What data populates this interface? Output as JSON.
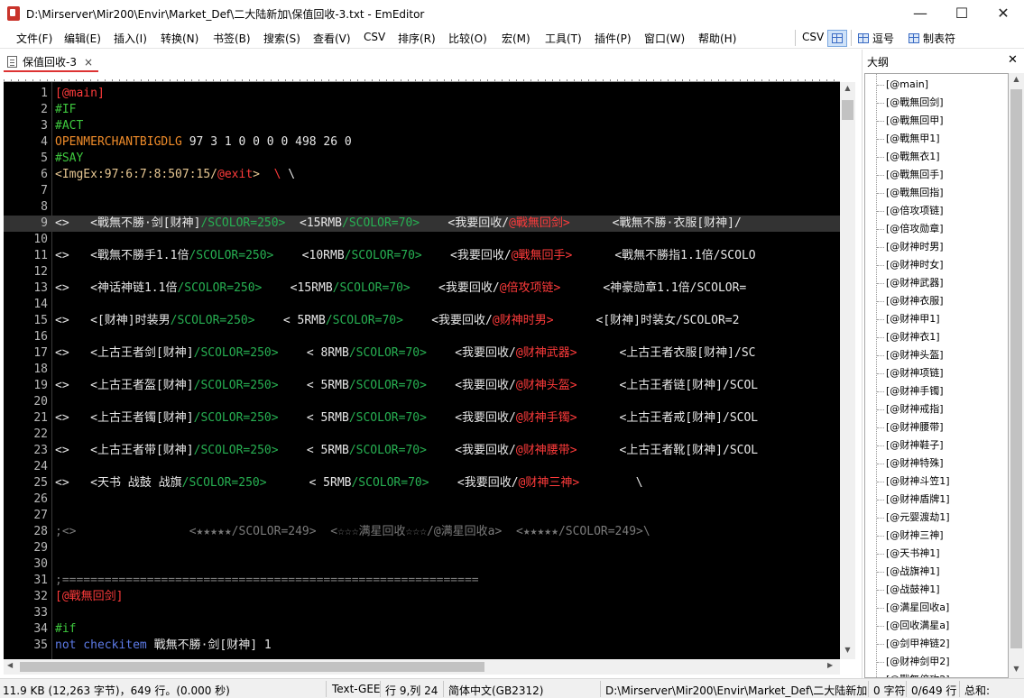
{
  "window": {
    "title": "D:\\Mirserver\\Mir200\\Envir\\Market_Def\\二大陆新加\\保值回收-3.txt - EmEditor",
    "minimize": "—",
    "maximize": "☐",
    "close": "✕"
  },
  "menu": [
    "文件(F)",
    "编辑(E)",
    "插入(I)",
    "转换(N)",
    "书签(B)",
    "搜索(S)",
    "查看(V)",
    "CSV",
    "排序(R)",
    "比较(O)",
    "宏(M)",
    "工具(T)",
    "插件(P)",
    "窗口(W)",
    "帮助(H)"
  ],
  "toolbar": {
    "csv_label": "CSV",
    "comma_label": "逗号",
    "tab_label": "制表符"
  },
  "tab": {
    "label": "保值回收-3",
    "close": "×"
  },
  "editor": {
    "current_line": 9,
    "lines": [
      {
        "n": "1",
        "segs": [
          {
            "t": "[@main]",
            "c": "r"
          }
        ]
      },
      {
        "n": "2",
        "segs": [
          {
            "t": "#IF",
            "c": "g"
          }
        ]
      },
      {
        "n": "3",
        "segs": [
          {
            "t": "#ACT",
            "c": "g"
          }
        ]
      },
      {
        "n": "4",
        "segs": [
          {
            "t": "OPENMERCHANTBIGDLG",
            "c": "o"
          },
          {
            "t": " 97 3 1 0 0 0 0 498 26 0",
            "c": "w"
          }
        ]
      },
      {
        "n": "5",
        "segs": [
          {
            "t": "#SAY",
            "c": "g"
          }
        ]
      },
      {
        "n": "6",
        "segs": [
          {
            "t": "<ImgEx:97:6:7:8:507:15/",
            "c": "t"
          },
          {
            "t": "@exit",
            "c": "r"
          },
          {
            "t": ">  ",
            "c": "t"
          },
          {
            "t": "\\",
            "c": "r"
          },
          {
            "t": " \\",
            "c": "w"
          }
        ]
      },
      {
        "n": "7",
        "segs": []
      },
      {
        "n": "8",
        "segs": []
      },
      {
        "n": "9",
        "segs": [
          {
            "t": "<>   <戰無不勝·剑[财神]",
            "c": "w"
          },
          {
            "t": "/SCOLOR=250>",
            "c": "gr"
          },
          {
            "t": "  <15RMB",
            "c": "w"
          },
          {
            "t": "/SCOLOR=70>",
            "c": "gr"
          },
          {
            "t": "    <我要回收/",
            "c": "w"
          },
          {
            "t": "@戰無回剑>",
            "c": "r"
          },
          {
            "t": "      <戰無不勝·衣服[财神]/",
            "c": "w"
          }
        ]
      },
      {
        "n": "10",
        "segs": []
      },
      {
        "n": "11",
        "segs": [
          {
            "t": "<>   <戰無不勝手1.1倍",
            "c": "w"
          },
          {
            "t": "/SCOLOR=250>",
            "c": "gr"
          },
          {
            "t": "    <10RMB",
            "c": "w"
          },
          {
            "t": "/SCOLOR=70>",
            "c": "gr"
          },
          {
            "t": "    <我要回收/",
            "c": "w"
          },
          {
            "t": "@戰無回手>",
            "c": "r"
          },
          {
            "t": "      <戰無不勝指1.1倍/SCOLO",
            "c": "w"
          }
        ]
      },
      {
        "n": "12",
        "segs": []
      },
      {
        "n": "13",
        "segs": [
          {
            "t": "<>   <神话神链1.1倍",
            "c": "w"
          },
          {
            "t": "/SCOLOR=250>",
            "c": "gr"
          },
          {
            "t": "    <15RMB",
            "c": "w"
          },
          {
            "t": "/SCOLOR=70>",
            "c": "gr"
          },
          {
            "t": "    <我要回收/",
            "c": "w"
          },
          {
            "t": "@倍攻项链>",
            "c": "r"
          },
          {
            "t": "      <神豪勋章1.1倍/SCOLOR=",
            "c": "w"
          }
        ]
      },
      {
        "n": "14",
        "segs": []
      },
      {
        "n": "15",
        "segs": [
          {
            "t": "<>   <[财神]时装男",
            "c": "w"
          },
          {
            "t": "/SCOLOR=250>",
            "c": "gr"
          },
          {
            "t": "    < 5RMB",
            "c": "w"
          },
          {
            "t": "/SCOLOR=70>",
            "c": "gr"
          },
          {
            "t": "    <我要回收/",
            "c": "w"
          },
          {
            "t": "@财神时男>",
            "c": "r"
          },
          {
            "t": "      <[财神]时装女/SCOLOR=2",
            "c": "w"
          }
        ]
      },
      {
        "n": "16",
        "segs": []
      },
      {
        "n": "17",
        "segs": [
          {
            "t": "<>   <上古王者剑[财神]",
            "c": "w"
          },
          {
            "t": "/SCOLOR=250>",
            "c": "gr"
          },
          {
            "t": "    < 8RMB",
            "c": "w"
          },
          {
            "t": "/SCOLOR=70>",
            "c": "gr"
          },
          {
            "t": "    <我要回收/",
            "c": "w"
          },
          {
            "t": "@财神武器>",
            "c": "r"
          },
          {
            "t": "      <上古王者衣服[财神]/SC",
            "c": "w"
          }
        ]
      },
      {
        "n": "18",
        "segs": []
      },
      {
        "n": "19",
        "segs": [
          {
            "t": "<>   <上古王者盔[财神]",
            "c": "w"
          },
          {
            "t": "/SCOLOR=250>",
            "c": "gr"
          },
          {
            "t": "    < 5RMB",
            "c": "w"
          },
          {
            "t": "/SCOLOR=70>",
            "c": "gr"
          },
          {
            "t": "    <我要回收/",
            "c": "w"
          },
          {
            "t": "@财神头盔>",
            "c": "r"
          },
          {
            "t": "      <上古王者链[财神]/SCOL",
            "c": "w"
          }
        ]
      },
      {
        "n": "20",
        "segs": []
      },
      {
        "n": "21",
        "segs": [
          {
            "t": "<>   <上古王者镯[财神]",
            "c": "w"
          },
          {
            "t": "/SCOLOR=250>",
            "c": "gr"
          },
          {
            "t": "    < 5RMB",
            "c": "w"
          },
          {
            "t": "/SCOLOR=70>",
            "c": "gr"
          },
          {
            "t": "    <我要回收/",
            "c": "w"
          },
          {
            "t": "@财神手镯>",
            "c": "r"
          },
          {
            "t": "      <上古王者戒[财神]/SCOL",
            "c": "w"
          }
        ]
      },
      {
        "n": "22",
        "segs": []
      },
      {
        "n": "23",
        "segs": [
          {
            "t": "<>   <上古王者带[财神]",
            "c": "w"
          },
          {
            "t": "/SCOLOR=250>",
            "c": "gr"
          },
          {
            "t": "    < 5RMB",
            "c": "w"
          },
          {
            "t": "/SCOLOR=70>",
            "c": "gr"
          },
          {
            "t": "    <我要回收/",
            "c": "w"
          },
          {
            "t": "@财神腰带>",
            "c": "r"
          },
          {
            "t": "      <上古王者靴[财神]/SCOL",
            "c": "w"
          }
        ]
      },
      {
        "n": "24",
        "segs": []
      },
      {
        "n": "25",
        "segs": [
          {
            "t": "<>   <天书 战鼓 战旗",
            "c": "w"
          },
          {
            "t": "/SCOLOR=250>",
            "c": "gr"
          },
          {
            "t": "      < 5RMB",
            "c": "w"
          },
          {
            "t": "/SCOLOR=70>",
            "c": "gr"
          },
          {
            "t": "    <我要回收/",
            "c": "w"
          },
          {
            "t": "@财神三神>",
            "c": "r"
          },
          {
            "t": "        \\",
            "c": "w"
          }
        ]
      },
      {
        "n": "26",
        "segs": []
      },
      {
        "n": "27",
        "segs": []
      },
      {
        "n": "28",
        "segs": [
          {
            "t": ";<>                <★★★★★/SCOLOR=249>  <☆☆☆满星回收☆☆☆/@满星回收a>  <★★★★★/SCOLOR=249>\\",
            "c": "dg"
          }
        ]
      },
      {
        "n": "29",
        "segs": []
      },
      {
        "n": "30",
        "segs": []
      },
      {
        "n": "31",
        "segs": [
          {
            "t": ";===========================================================",
            "c": "dg"
          }
        ]
      },
      {
        "n": "32",
        "segs": [
          {
            "t": "[@戰無回剑]",
            "c": "r"
          }
        ]
      },
      {
        "n": "33",
        "segs": []
      },
      {
        "n": "34",
        "segs": [
          {
            "t": "#if",
            "c": "g"
          }
        ]
      },
      {
        "n": "35",
        "segs": [
          {
            "t": "not checkitem",
            "c": "b"
          },
          {
            "t": " 戰無不勝·剑[财神] 1",
            "c": "w"
          }
        ]
      }
    ]
  },
  "outline": {
    "title": "大纲",
    "close": "✕",
    "items": [
      "[@main]",
      "[@戰無回剑]",
      "[@戰無回甲]",
      "[@戰無甲1]",
      "[@戰無衣1]",
      "[@戰無回手]",
      "[@戰無回指]",
      "[@倍攻项链]",
      "[@倍攻勋章]",
      "[@财神时男]",
      "[@财神时女]",
      "[@财神武器]",
      "[@财神衣服]",
      "[@财神甲1]",
      "[@财神衣1]",
      "[@财神头盔]",
      "[@财神项链]",
      "[@财神手镯]",
      "[@财神戒指]",
      "[@财神腰带]",
      "[@财神鞋子]",
      "[@财神特殊]",
      "[@财神斗笠1]",
      "[@财神盾牌1]",
      "[@元婴渡劫1]",
      "[@财神三神]",
      "[@天书神1]",
      "[@战旗神1]",
      "[@战鼓神1]",
      "[@满星回收a]",
      "[@回收满星a]",
      "[@剑甲神链2]",
      "[@财神剑甲2]",
      "[@戰無倍攻2]"
    ]
  },
  "status": {
    "size": "11.9 KB (12,263 字节)，649 行。(0.000 秒)",
    "mode": "Text-GEE",
    "position": "行 9,列 24",
    "encoding": "简体中文(GB2312)",
    "path": "D:\\Mirserver\\Mir200\\Envir\\Market_Def\\二大陆新加",
    "chars": "0 字符",
    "lines": "0/649 行",
    "total": "总和:"
  }
}
